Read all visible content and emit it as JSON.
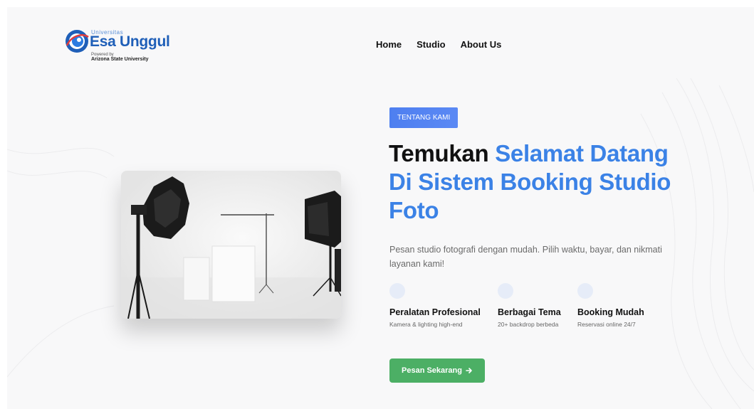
{
  "logo": {
    "small": "Universitas",
    "main": "Esa Unggul",
    "powered": "Powered by",
    "partner": "Arizona State University"
  },
  "nav": {
    "items": [
      {
        "label": "Home"
      },
      {
        "label": "Studio"
      },
      {
        "label": "About Us"
      }
    ]
  },
  "hero": {
    "badge": "TENTANG KAMI",
    "headline_plain": "Temukan",
    "headline_accent": "Selamat Datang Di Sistem Booking Studio Foto",
    "description": "Pesan studio fotografi dengan mudah. Pilih waktu, bayar, dan nikmati layanan kami!",
    "features": [
      {
        "title": "Peralatan Profesional",
        "subtitle": "Kamera & lighting high-end"
      },
      {
        "title": "Berbagai Tema",
        "subtitle": "20+ backdrop berbeda"
      },
      {
        "title": "Booking Mudah",
        "subtitle": "Reservasi online 24/7"
      }
    ],
    "cta_label": "Pesan Sekarang",
    "cta_icon": "arrow-right-icon"
  },
  "colors": {
    "accent": "#3b82e6",
    "badge": "#5086f2",
    "cta": "#4caf65",
    "brand": "#1f5fb8"
  }
}
